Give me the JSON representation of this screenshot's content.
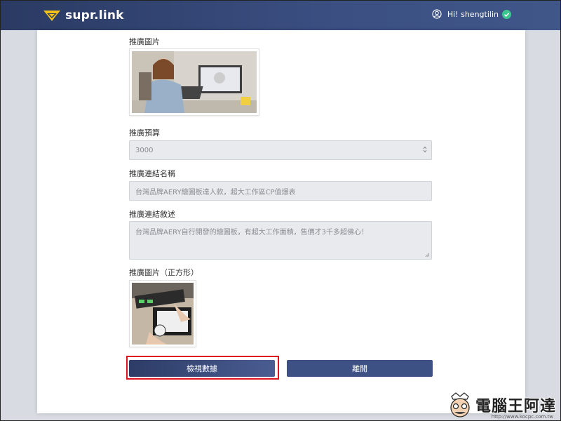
{
  "header": {
    "logo_text": "supr.link",
    "greeting": "Hi! shengtilin"
  },
  "form": {
    "promo_image_label": "推廣圖片",
    "budget_label": "推廣預算",
    "budget_value": "3000",
    "link_name_label": "推廣連結名稱",
    "link_name_value": "台灣品牌AERY繪圖板達人款，超大工作區CP值爆表",
    "link_desc_label": "推廣連結敘述",
    "link_desc_value": "台灣品牌AERY自行開發的繪圖板，有超大工作面積，售價才3千多超佛心！",
    "square_image_label": "推廣圖片（正方形）"
  },
  "buttons": {
    "view_data": "檢視數據",
    "leave": "離開"
  },
  "watermark": {
    "text": "電腦王阿達",
    "url": "http://www.kocpc.com.tw"
  },
  "colors": {
    "header_bg": "#2f416e",
    "button": "#3e5185",
    "highlight": "#e0141e",
    "verified": "#3cc78f"
  }
}
